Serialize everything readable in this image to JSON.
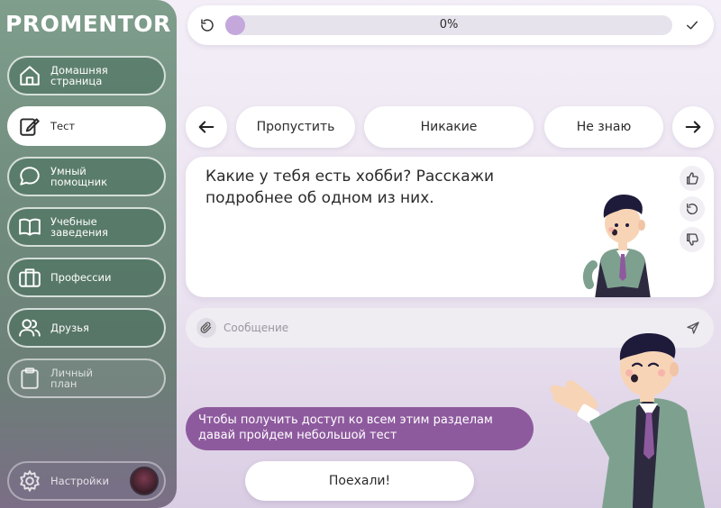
{
  "brand": {
    "logo": "PROMENTOR"
  },
  "sidebar": {
    "items": [
      {
        "label": "Домашняя\nстраница",
        "icon": "home-icon"
      },
      {
        "label": "Тест",
        "icon": "edit-icon"
      },
      {
        "label": "Умный\nпомощник",
        "icon": "chat-icon"
      },
      {
        "label": "Учебные\nзаведения",
        "icon": "book-icon"
      },
      {
        "label": "Профессии",
        "icon": "briefcase-icon"
      },
      {
        "label": "Друзья",
        "icon": "friends-icon"
      },
      {
        "label": "Личный\nплан",
        "icon": "clipboard-icon"
      }
    ],
    "settings_label": "Настройки"
  },
  "progress": {
    "value_text": "0%",
    "value": 0
  },
  "answers": {
    "skip": "Пропустить",
    "none": "Никакие",
    "dont_know": "Не знаю"
  },
  "question": {
    "text": "Какие у тебя есть хобби? Расскажи подробнее об одном из них."
  },
  "message": {
    "placeholder": "Сообщение"
  },
  "prompt_bubble": "Чтобы получить доступ ко всем этим разделам давай пройдем небольшой тест",
  "start_button": "Поехали!",
  "colors": {
    "sidebar_green": "#7f9e8c",
    "accent_purple": "#8e5a9e",
    "progress_knob": "#c4a8dc",
    "background": "#f3eef7"
  }
}
